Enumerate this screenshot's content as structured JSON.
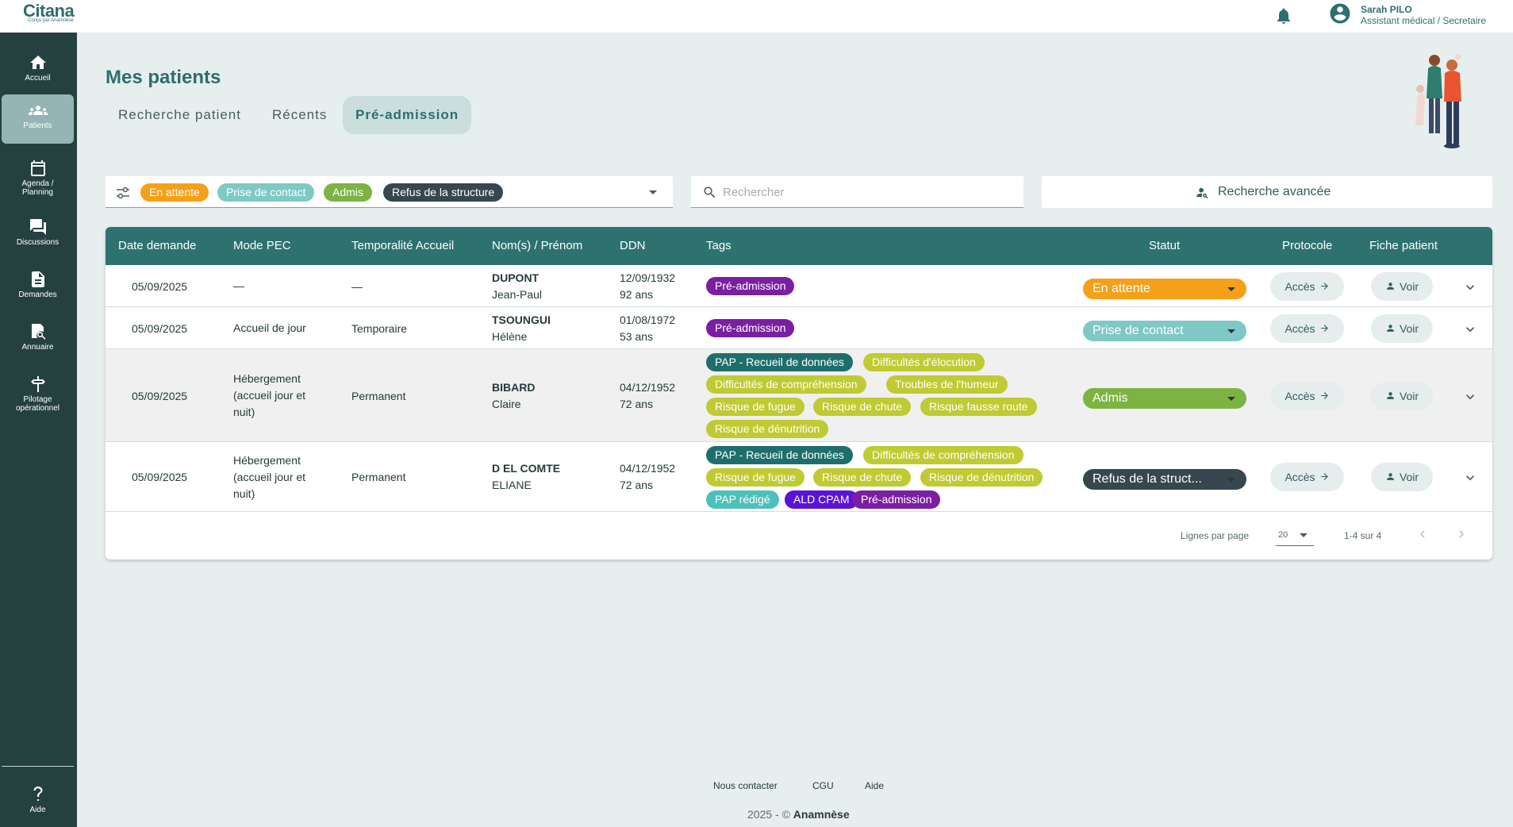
{
  "app": {
    "logo": "Citana",
    "logo_sub": "Conçu par Anamnèse"
  },
  "user": {
    "name": "Sarah PILO",
    "role": "Assistant médical / Secretaire"
  },
  "sidebar": {
    "items": [
      {
        "label": "Accueil",
        "icon": "home-icon"
      },
      {
        "label": "Patients",
        "icon": "people-icon",
        "active": true
      },
      {
        "label1": "Agenda /",
        "label2": "Planning",
        "icon": "calendar-icon"
      },
      {
        "label": "Discussions",
        "icon": "chat-icon"
      },
      {
        "label": "Demandes",
        "icon": "document-icon"
      },
      {
        "label": "Annuaire",
        "icon": "directory-icon"
      },
      {
        "label1": "Pilotage",
        "label2": "opérationnel",
        "icon": "steering-icon"
      }
    ],
    "help": "Aide"
  },
  "page": {
    "title": "Mes patients",
    "tabs": [
      "Recherche patient",
      "Récents",
      "Pré-admission"
    ],
    "active_tab": "Pré-admission"
  },
  "filters": {
    "chips": [
      {
        "label": "En attente",
        "color": "#f5a01a"
      },
      {
        "label": "Prise de contact",
        "color": "#7ec9c5"
      },
      {
        "label": "Admis",
        "color": "#7cb342"
      },
      {
        "label": "Refus de la structure",
        "color": "#37474f"
      }
    ],
    "search_placeholder": "Rechercher",
    "advanced_search": "Recherche avancée"
  },
  "table": {
    "columns": [
      "Date demande",
      "Mode PEC",
      "Temporalité Accueil",
      "Nom(s) / Prénom",
      "DDN",
      "Tags",
      "Statut",
      "Protocole",
      "Fiche patient"
    ],
    "protocol_label": "Accès",
    "fiche_label": "Voir",
    "rows": [
      {
        "date": "05/09/2025",
        "mode_pec": [
          "—"
        ],
        "temporalite": "—",
        "nom": "DUPONT",
        "prenom": "Jean-Paul",
        "ddn": "12/09/1932",
        "age": "92 ans",
        "tags": [
          [
            {
              "label": "Pré-admission",
              "color": "#7b1fa2"
            }
          ]
        ],
        "statut": {
          "label": "En attente",
          "color": "#f5a01a"
        }
      },
      {
        "date": "05/09/2025",
        "mode_pec": [
          "Accueil de jour"
        ],
        "temporalite": "Temporaire",
        "nom": "TSOUNGUI",
        "prenom": "Hélène",
        "ddn": "01/08/1972",
        "age": "53 ans",
        "tags": [
          [
            {
              "label": "Pré-admission",
              "color": "#7b1fa2"
            }
          ]
        ],
        "statut": {
          "label": "Prise de contact",
          "color": "#7ec9c5"
        }
      },
      {
        "date": "05/09/2025",
        "mode_pec": [
          "Hébergement",
          "(accueil jour et",
          "nuit)"
        ],
        "temporalite": "Permanent",
        "nom": "BIBARD",
        "prenom": "Claire",
        "ddn": "04/12/1952",
        "age": "72 ans",
        "tags": [
          [
            {
              "label": "PAP - Recueil de données",
              "color": "#1e6f6b"
            },
            {
              "label": "Difficultés d'élocution",
              "color": "#c0ca33"
            }
          ],
          [
            {
              "label": "Difficultés de compréhension",
              "color": "#c0ca33"
            },
            {
              "label": "Troubles de l'humeur",
              "color": "#c0ca33"
            }
          ],
          [
            {
              "label": "Risque de fugue",
              "color": "#c0ca33"
            },
            {
              "label": "Risque de chute",
              "color": "#c0ca33"
            },
            {
              "label": "Risque fausse route",
              "color": "#c0ca33"
            }
          ],
          [
            {
              "label": "Risque de dénutrition",
              "color": "#c0ca33"
            }
          ]
        ],
        "statut": {
          "label": "Admis",
          "color": "#7cb342"
        }
      },
      {
        "date": "05/09/2025",
        "mode_pec": [
          "Hébergement",
          "(accueil jour et",
          "nuit)"
        ],
        "temporalite": "Permanent",
        "nom": "D EL COMTE",
        "prenom": "ELIANE",
        "ddn": "04/12/1952",
        "age": "72 ans",
        "tags": [
          [
            {
              "label": "PAP - Recueil de données",
              "color": "#1e6f6b"
            },
            {
              "label": "Difficultés de compréhension",
              "color": "#c0ca33"
            }
          ],
          [
            {
              "label": "Risque de fugue",
              "color": "#c0ca33"
            },
            {
              "label": "Risque de chute",
              "color": "#c0ca33"
            },
            {
              "label": "Risque de dénutrition",
              "color": "#c0ca33"
            }
          ],
          [
            {
              "label": "PAP rédigé",
              "color": "#4dc0bb"
            },
            {
              "label": "ALD CPAM",
              "color": "#5b13d6"
            },
            {
              "label": "Pré-admission",
              "color": "#7b1fa2"
            }
          ]
        ],
        "statut": {
          "label": "Refus de la struct...",
          "color": "#37474f"
        }
      }
    ]
  },
  "pagination": {
    "rows_per_page_label": "Lignes par page",
    "rows_per_page": "20",
    "range": "1-4 sur 4"
  },
  "footer": {
    "links": [
      "Nous contacter",
      "CGU",
      "Aide"
    ],
    "copyright_prefix": "2025 - ©",
    "copyright_brand": "Anamnèse"
  }
}
